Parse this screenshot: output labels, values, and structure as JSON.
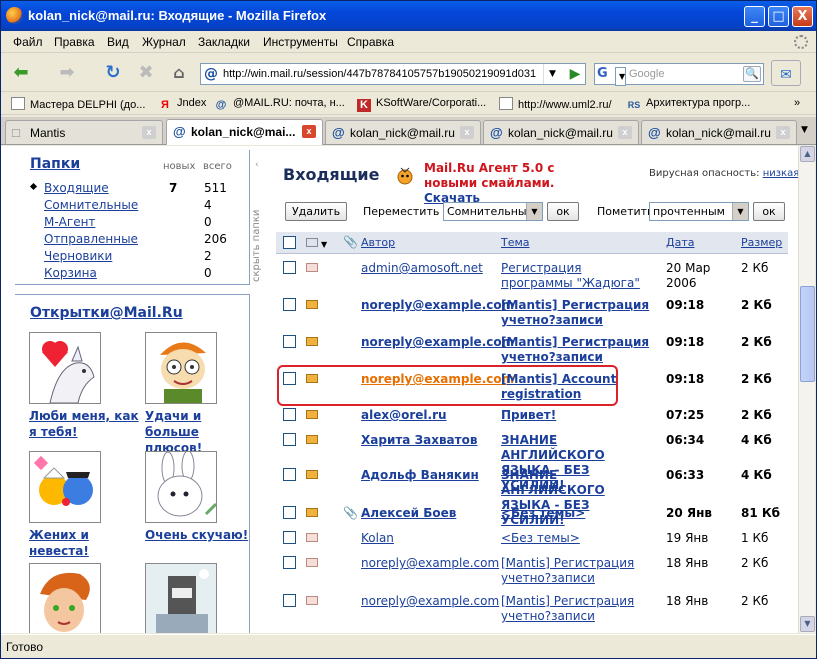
{
  "window": {
    "title": "kolan_nick@mail.ru: Входящие - Mozilla Firefox",
    "controls": {
      "min": "_",
      "max": "□",
      "close": "X"
    }
  },
  "menu": [
    "Файл",
    "Правка",
    "Вид",
    "Журнал",
    "Закладки",
    "Инструменты",
    "Справка"
  ],
  "nav": {
    "url": "http://win.mail.ru/session/447b78784105757b19050219091d031",
    "search_placeholder": "Google",
    "search_engine": "G"
  },
  "bookmarks": [
    {
      "label": "Мастера DELPHI (до...",
      "icon": "page-icon"
    },
    {
      "label": "Jndex",
      "icon": "yandex-icon"
    },
    {
      "label": "@MAIL.RU: почта, н...",
      "icon": "mailru-icon"
    },
    {
      "label": "KSoftWare/Corporati...",
      "icon": "ksoft-icon"
    },
    {
      "label": "http://www.uml2.ru/",
      "icon": "page-icon"
    },
    {
      "label": "Архитектура прогр...",
      "icon": "rsdn-icon"
    }
  ],
  "tabs": [
    {
      "label": "Mantis",
      "icon": "@"
    },
    {
      "label": "kolan_nick@mai...",
      "icon": "@",
      "active": true
    },
    {
      "label": "kolan_nick@mail.ru...",
      "icon": "@"
    },
    {
      "label": "kolan_nick@mail.ru...",
      "icon": "@"
    },
    {
      "label": "kolan_nick@mail.ru...",
      "icon": "@"
    }
  ],
  "status": "Готово",
  "folders": {
    "title": "Папки",
    "col_new": "новых",
    "col_total": "всего",
    "hide_label": "скрыть папки",
    "items": [
      {
        "name": "Входящие",
        "new": "7",
        "total": "511",
        "current": true
      },
      {
        "name": "Сомнительные",
        "new": "",
        "total": "4"
      },
      {
        "name": "М-Агент",
        "new": "",
        "total": "0"
      },
      {
        "name": "Отправленные",
        "new": "",
        "total": "206"
      },
      {
        "name": "Черновики",
        "new": "",
        "total": "2"
      },
      {
        "name": "Корзина",
        "new": "",
        "total": "0"
      }
    ]
  },
  "cards": {
    "title": "Открытки@Mail.Ru",
    "items": [
      "Люби меня, как я тебя!",
      "Удачи и больше плюсов!",
      "Жених и невеста!",
      "Очень скучаю!"
    ]
  },
  "inbox": {
    "title": "Входящие",
    "agent_text": "Mail.Ru Агент 5.0 с новыми смайлами.",
    "agent_link": "Скачать",
    "virus_label": "Вирусная опасность:",
    "virus_level": "низкая",
    "delete_btn": "Удалить",
    "move_label": "Переместить в",
    "move_value": "Сомнительные",
    "ok": "ок",
    "mark_label": "Пометить",
    "mark_value": "прочтенным",
    "headers": {
      "from": "Автор",
      "subject": "Тема",
      "date": "Дата",
      "size": "Размер"
    },
    "rows": [
      {
        "from": "admin@amosoft.net",
        "subject": "Регистрация программы \"Жадюга\"",
        "date": "20 Мар 2006",
        "size": "2 Кб",
        "unread": false,
        "attach": false
      },
      {
        "from": "noreply@example.com",
        "subject": "[Mantis] Регистрация учетно?записи",
        "date": "09:18",
        "size": "2 Кб",
        "unread": true,
        "attach": false
      },
      {
        "from": "noreply@example.com",
        "subject": "[Mantis] Регистрация учетно?записи",
        "date": "09:18",
        "size": "2 Кб",
        "unread": true,
        "attach": false
      },
      {
        "from": "noreply@example.com",
        "subject": "[Mantis] Account registration",
        "date": "09:18",
        "size": "2 Кб",
        "unread": true,
        "attach": false,
        "highlight": true
      },
      {
        "from": "alex@orel.ru",
        "subject": "Привет!",
        "date": "07:25",
        "size": "2 Кб",
        "unread": true,
        "attach": false
      },
      {
        "from": "Харита Захватов",
        "subject": "ЗНАНИЕ АНГЛИЙСКОГО ЯЗЫКА - БЕЗ УСИЛИЙ!",
        "date": "06:34",
        "size": "4 Кб",
        "unread": true,
        "attach": false
      },
      {
        "from": "Адольф Ванякин",
        "subject": "ЗНАНИЕ АНГЛИЙСКОГО ЯЗЫКА - БЕЗ УСИЛИЙ!",
        "date": "06:33",
        "size": "4 Кб",
        "unread": true,
        "attach": false
      },
      {
        "from": "Алексей Боев",
        "subject": "<Без темы>",
        "date": "20 Янв",
        "size": "81 Кб",
        "unread": true,
        "attach": true
      },
      {
        "from": "Kolan",
        "subject": "<Без темы>",
        "date": "19 Янв",
        "size": "1 Кб",
        "unread": false,
        "attach": false
      },
      {
        "from": "noreply@example.com",
        "subject": "[Mantis] Регистрация учетно?записи",
        "date": "18 Янв",
        "size": "2 Кб",
        "unread": false,
        "attach": false
      },
      {
        "from": "noreply@example.com",
        "subject": "[Mantis] Регистрация учетно?записи",
        "date": "18 Янв",
        "size": "2 Кб",
        "unread": false,
        "attach": false
      }
    ]
  }
}
